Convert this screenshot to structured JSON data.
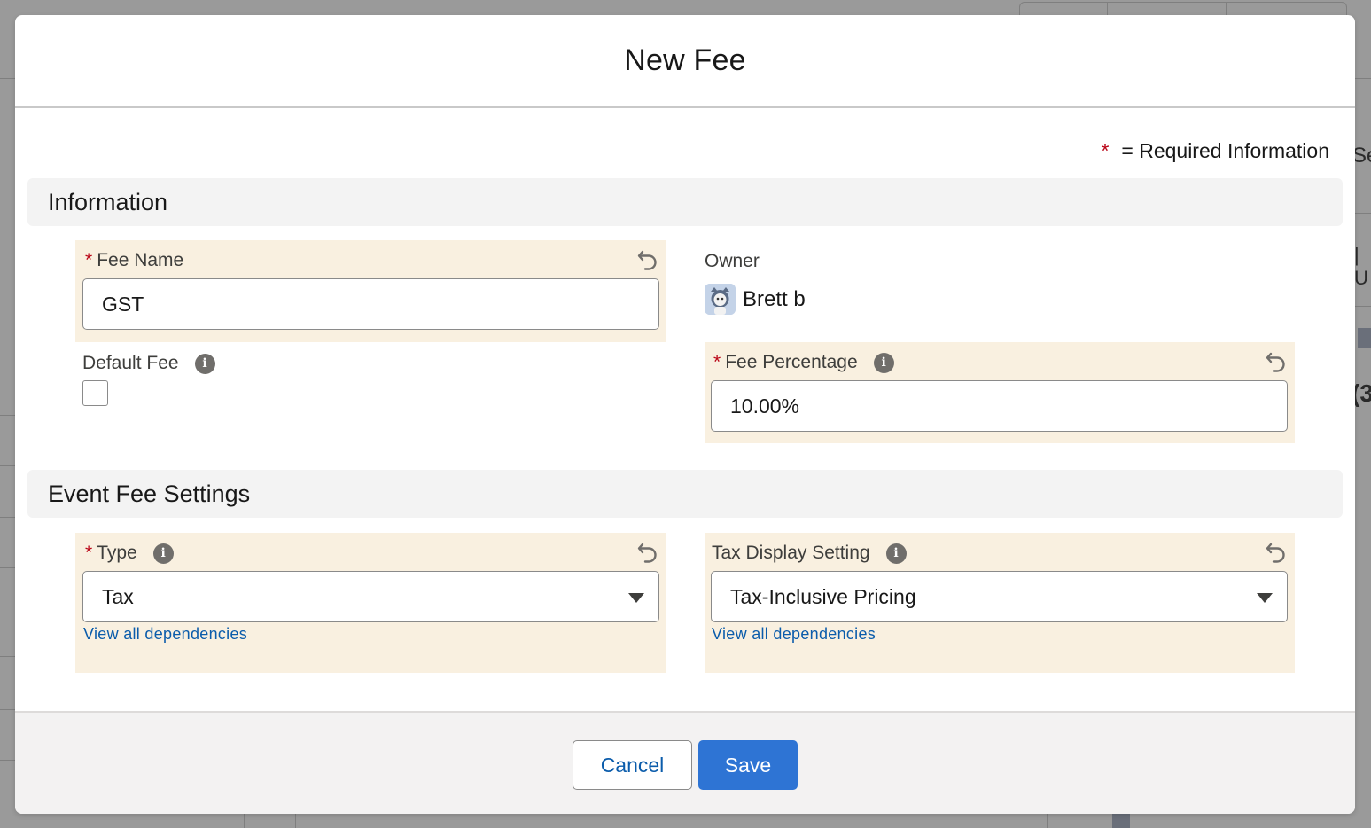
{
  "modal": {
    "title": "New Fee",
    "required_legend_star": "*",
    "required_legend_text": "= Required Information"
  },
  "sections": {
    "information": {
      "title": "Information"
    },
    "event_fee_settings": {
      "title": "Event Fee Settings"
    }
  },
  "fields": {
    "fee_name": {
      "required": "*",
      "label": "Fee Name",
      "value": "GST"
    },
    "owner": {
      "label": "Owner",
      "value": "Brett b"
    },
    "default_fee": {
      "label": "Default Fee",
      "checked": false
    },
    "fee_percentage": {
      "required": "*",
      "label": "Fee Percentage",
      "value": "10.00%"
    },
    "type": {
      "required": "*",
      "label": "Type",
      "value": "Tax",
      "dependencies_link": "View all dependencies"
    },
    "tax_display_setting": {
      "label": "Tax Display Setting",
      "value": "Tax-Inclusive Pricing",
      "dependencies_link": "View all dependencies"
    }
  },
  "icons": {
    "info": "i"
  },
  "footer": {
    "cancel_label": "Cancel",
    "save_label": "Save"
  },
  "colors": {
    "accent": "#2e74d4",
    "link": "#0b5cab",
    "required": "#ba0517",
    "edited_field_bg": "#f9f0e0"
  },
  "background": {
    "right_edge_text_1": "Se",
    "right_edge_text_2": "| U",
    "right_edge_text_3": "(3"
  }
}
